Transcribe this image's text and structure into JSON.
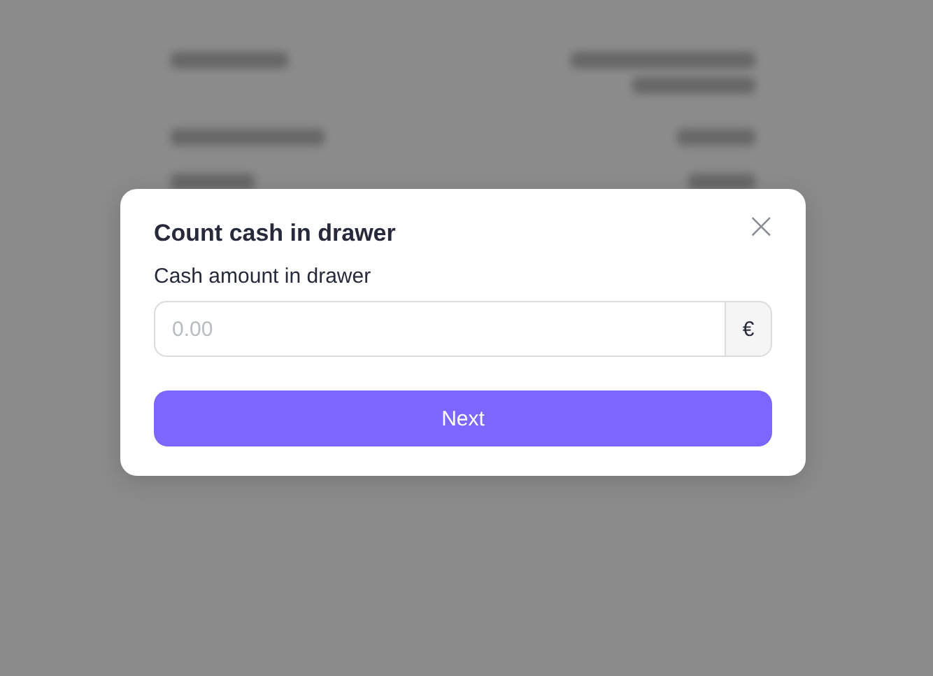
{
  "dialog": {
    "title": "Count cash in drawer",
    "close_icon": "×",
    "field": {
      "label": "Cash amount in drawer",
      "placeholder": "0.00",
      "suffix": "€"
    },
    "button": "Next"
  }
}
